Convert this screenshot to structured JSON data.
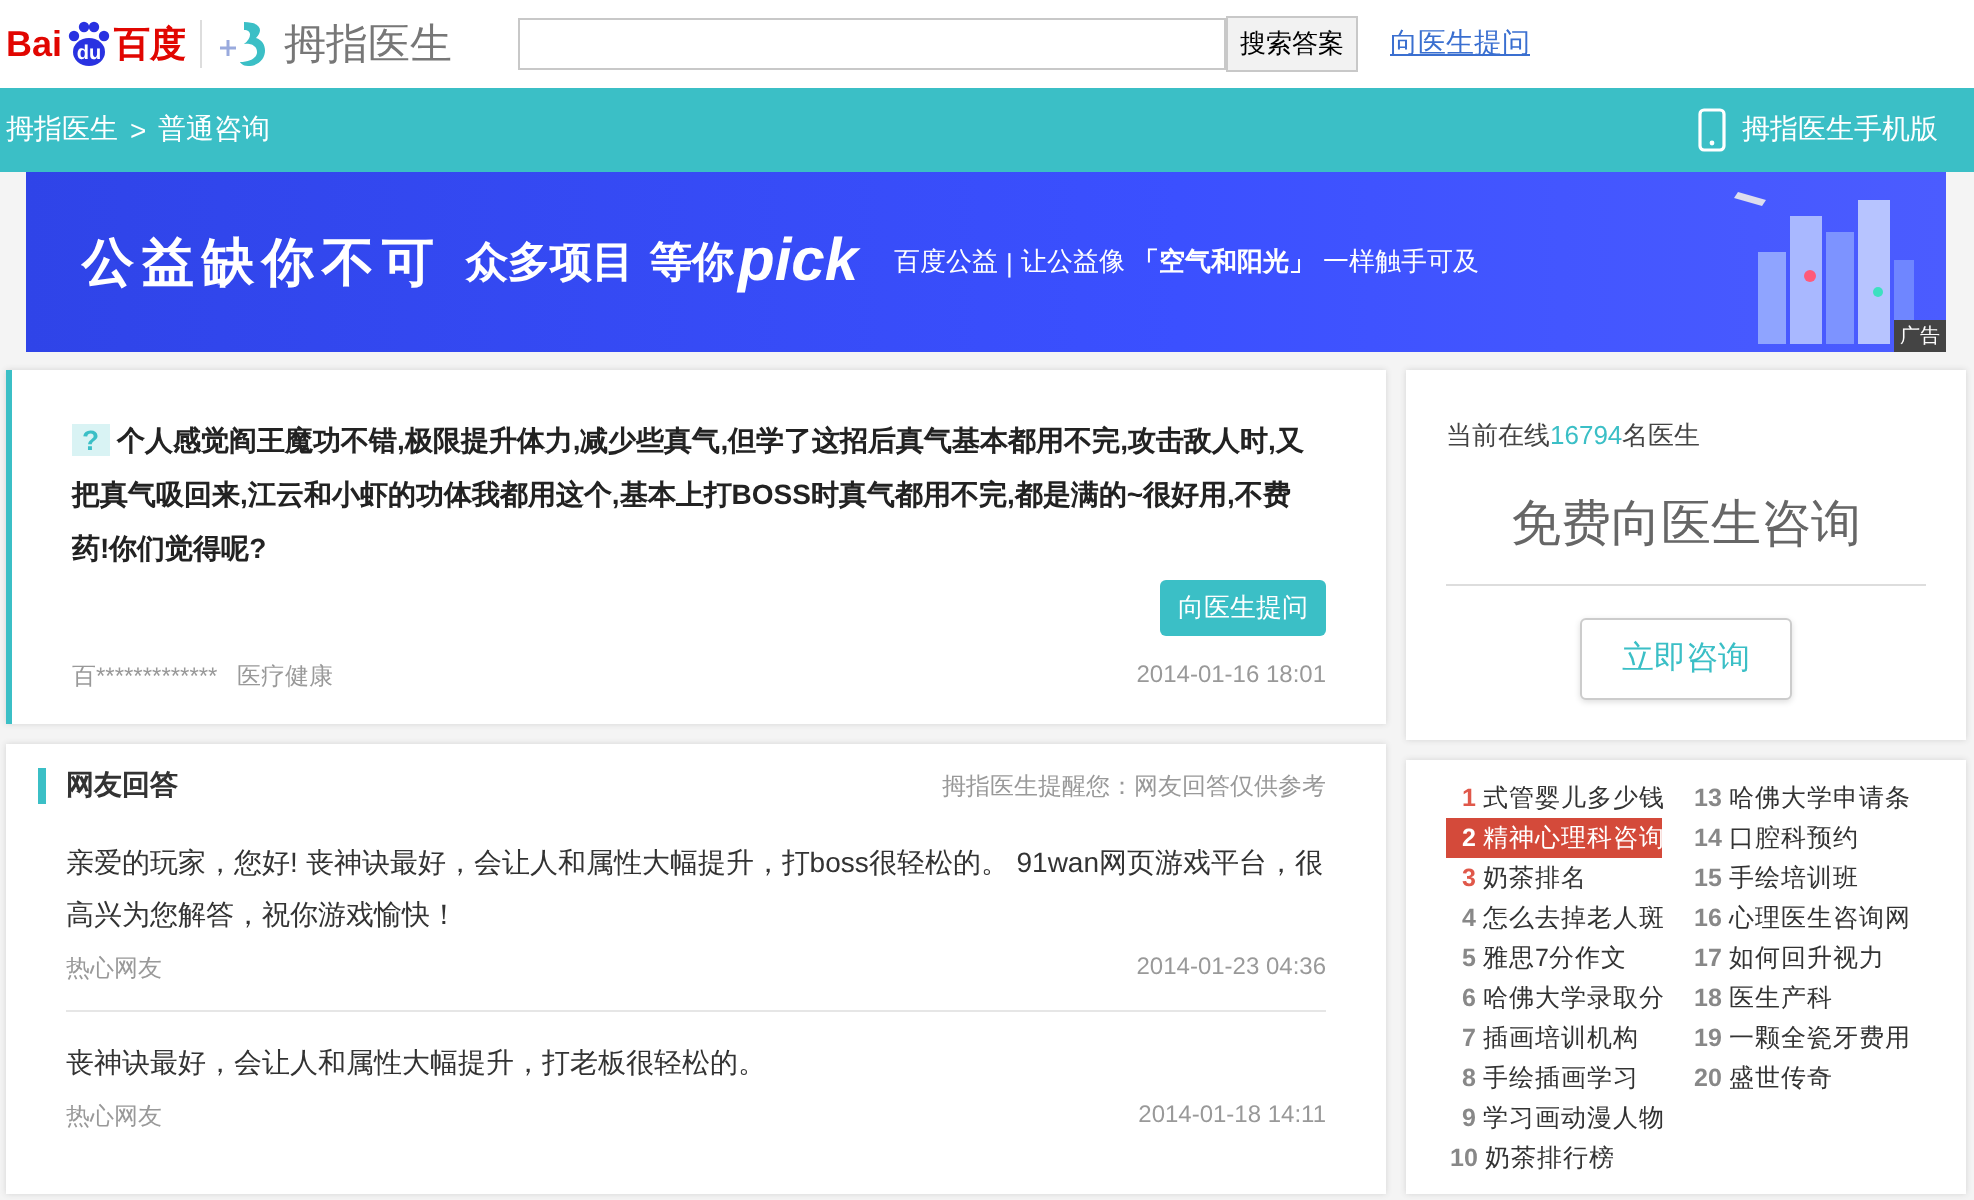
{
  "header": {
    "logo": {
      "left": "Bai",
      "paw": "du",
      "right": "百度"
    },
    "brand": "拇指医生",
    "search": {
      "button": "搜索答案"
    },
    "ask_link": "向医生提问"
  },
  "breadcrumb": {
    "items": [
      "拇指医生",
      "普通咨询"
    ],
    "separator": ">",
    "mobile": "拇指医生手机版"
  },
  "banner": {
    "headline": "公益缺你不可",
    "sub": "众多项目",
    "wait": "等你",
    "pick": "pick",
    "org": "百度公益",
    "divider": "|",
    "slogan_a": "让公益像",
    "slogan_b": "「空气和阳光」",
    "slogan_c": "一样触手可及",
    "ad": "广告"
  },
  "question": {
    "badge": "?",
    "text": "个人感觉阎王魔功不错,极限提升体力,减少些真气,但学了这招后真气基本都用不完,攻击敌人时,又把真气吸回来,江云和小虾的功体我都用这个,基本上打BOSS时真气都用不完,都是满的~很好用,不费药!你们觉得呢?",
    "button": "向医生提问",
    "user": "百*************",
    "category": "医疗健康",
    "date": "2014-01-16 18:01"
  },
  "online": {
    "prefix": "当前在线",
    "count": "16794",
    "suffix": "名医生",
    "title": "免费向医生咨询",
    "button": "立即咨询"
  },
  "answers": {
    "title": "网友回答",
    "note": "拇指医生提醒您：网友回答仅供参考",
    "items": [
      {
        "text": "亲爱的玩家，您好! 丧神诀最好，会让人和属性大幅提升，打boss很轻松的。 91wan网页游戏平台，很高兴为您解答，祝你游戏愉快！",
        "author": "热心网友",
        "date": "2014-01-23 04:36"
      },
      {
        "text": "丧神诀最好，会让人和属性大幅提升，打老板很轻松的。",
        "author": "热心网友",
        "date": "2014-01-18 14:11"
      }
    ]
  },
  "hot_list": {
    "columns": [
      [
        {
          "rank": "1",
          "text": "式管婴儿多少钱",
          "hot": true,
          "selected": false
        },
        {
          "rank": "2",
          "text": "精神心理科咨询",
          "hot": true,
          "selected": true
        },
        {
          "rank": "3",
          "text": "奶茶排名",
          "hot": true,
          "selected": false
        },
        {
          "rank": "4",
          "text": "怎么去掉老人斑",
          "hot": false,
          "selected": false
        },
        {
          "rank": "5",
          "text": "雅思7分作文",
          "hot": false,
          "selected": false
        },
        {
          "rank": "6",
          "text": "哈佛大学录取分",
          "hot": false,
          "selected": false
        },
        {
          "rank": "7",
          "text": "插画培训机构",
          "hot": false,
          "selected": false
        },
        {
          "rank": "8",
          "text": "手绘插画学习",
          "hot": false,
          "selected": false
        },
        {
          "rank": "9",
          "text": "学习画动漫人物",
          "hot": false,
          "selected": false
        },
        {
          "rank": "10",
          "text": "奶茶排行榜",
          "hot": false,
          "selected": false
        }
      ],
      [
        {
          "rank": "13",
          "text": "哈佛大学申请条",
          "hot": false,
          "selected": false
        },
        {
          "rank": "14",
          "text": "口腔科预约",
          "hot": false,
          "selected": false
        },
        {
          "rank": "15",
          "text": "手绘培训班",
          "hot": false,
          "selected": false
        },
        {
          "rank": "16",
          "text": "心理医生咨询网",
          "hot": false,
          "selected": false
        },
        {
          "rank": "17",
          "text": "如何回升视力",
          "hot": false,
          "selected": false
        },
        {
          "rank": "18",
          "text": "医生产科",
          "hot": false,
          "selected": false
        },
        {
          "rank": "19",
          "text": "一颗全瓷牙费用",
          "hot": false,
          "selected": false
        },
        {
          "rank": "20",
          "text": "盛世传奇",
          "hot": false,
          "selected": false
        }
      ]
    ]
  }
}
